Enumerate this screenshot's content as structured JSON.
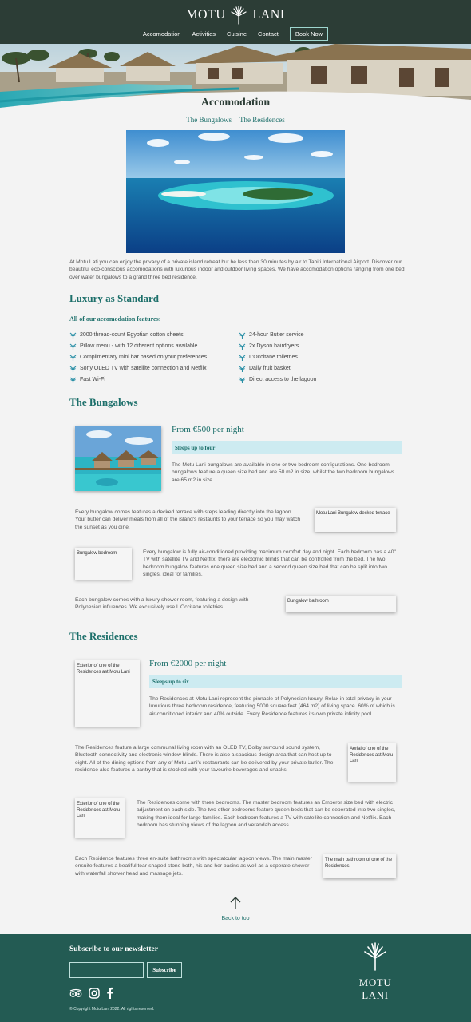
{
  "brand": {
    "name_left": "MOTU",
    "name_right": "LANI"
  },
  "nav": {
    "items": [
      "Accomodation",
      "Activities",
      "Cuisine",
      "Contact"
    ],
    "book_label": "Book Now"
  },
  "page": {
    "title": "Accomodation",
    "sublinks": [
      "The Bungalows",
      "The Residences"
    ],
    "intro": "At Motu Lati you can enjoy the privacy of a private island retreat but be less than 30 minutes by air to Tahiti International Airport. Discover our beautiful eco-conscious accomodations with luxurious indoor and outdoor living spaces. We have accomodation options ranging from one bed over water bungalows to a grand three bed residence."
  },
  "luxury": {
    "heading": "Luxury as Standard",
    "subheading": "All of our accomodation features:",
    "features_left": [
      "2000 thread-count Egyptian cotton sheets",
      "Pillow menu - with 12 different options available",
      "Complimentary mini bar based on your preferences",
      "Sony OLED TV with satellite connection and Netflix",
      "Fast Wi-Fi"
    ],
    "features_right": [
      "24-hour Butler service",
      "2x Dyson hairdryers",
      "L'Occitane toiletries",
      "Daily fruit basket",
      "Direct access to the lagoon"
    ]
  },
  "bungalows": {
    "heading": "The Bungalows",
    "price": "From €500 per night",
    "sleeps": "Sleeps up to four",
    "desc": "The Motu Lani bungalows are available in one or two bedroom configurations. One bedroom bungalows feature a queen size bed and are 50 m2 in size, whilst the two bedroom bungalows are 65 m2 in size.",
    "terrace_text": "Every bungalow comes features a decked terrace with steps leading directly into the lagoon. Your butler can deliver meals from all of the island's restaunts to your terrace so you may watch the sunset as you dine.",
    "terrace_alt": "Motu Lani Bungalow decked terrace",
    "bedroom_alt": "Bungalow bedroom",
    "bedroom_text": "Every bungalow is fully air-conditioned providing maximum comfort day and night. Each bedroom has a 40\" TV with satellite TV and Netflix, there are electornic blinds that can be controlled from the bed. The two bedroom bungalow features one queen size bed and a second queen size bed that can be split into two singles, ideal for families.",
    "bathroom_text": "Each bungalow comes with a luxury shower room, featuring a design with Polynesian influences. We exclusively use L'Occitane toiletries.",
    "bathroom_alt": "Bungalow bathroom"
  },
  "residences": {
    "heading": "The Residences",
    "exterior_alt": "Exterior of one of the Residences ast Motu Lani",
    "price": "From €2000 per night",
    "sleeps": "Sleeps up to six",
    "desc": "The Residences at Motu Lani represent the pinnacle of Polynesian luxury. Relax in total privacy in your luxurious three bedroom residence, featuring 5000 square feet (464 m2) of living space. 60% of which is air-conditioned interior and 40% outside. Every Residence features its own private infinity pool.",
    "living_text": "The Residences feature a large communal living room with an OLED TV, Dolby surround sound system, Bluetooth connectivity and electronic window blinds. There is also a spacious design area that can host up to eight. All of the dining options from any of Motu Lani's restaurants can be delivered by your private butler. The residence also features a pantry that is stocked with your favourite beverages and snacks.",
    "aerial_alt": "Aerial of one of the Residences ast Motu Lani",
    "exterior2_alt": "Exterior of one of the Residences ast Motu Lani",
    "bedrooms_text": "The Residences come with three bedrooms. The master bedroom features an Emperor size bed with electric adjustment on each side. The two other bedrooms feature queen beds that can be seperated into two singles, making them ideal for large families. Each bedroom features a TV with satellite connection and Netflix. Each bedroom has stunning views of the lagoon and verandah access.",
    "bath_text": "Each Residence features three en-suite bathrooms with spectatcular lagoon views. The main master ensuite features a beatiful tear-shaped stone both, his and her basins as well as a seperate shower with waterfall shower head and massage jets.",
    "bath_alt": "The main bathroom of one of the Residences."
  },
  "back_to_top": "Back to top",
  "footer": {
    "newsletter": "Subscribe to our newsletter",
    "subscribe_label": "Subscribe",
    "email_placeholder": "",
    "copyright": "© Copyright Motu Lani 2022. All rights reserved.",
    "logo_text": "MOTU LANI"
  },
  "colors": {
    "header_bg": "#2c3d36",
    "accent": "#1c6f6a",
    "footer_bg": "#235b53",
    "sleeps_bg": "#cdebf1"
  },
  "icons": [
    "palm-logo-icon",
    "coral-bullet-icon",
    "arrow-up-icon",
    "tripadvisor-icon",
    "instagram-icon",
    "facebook-icon"
  ]
}
